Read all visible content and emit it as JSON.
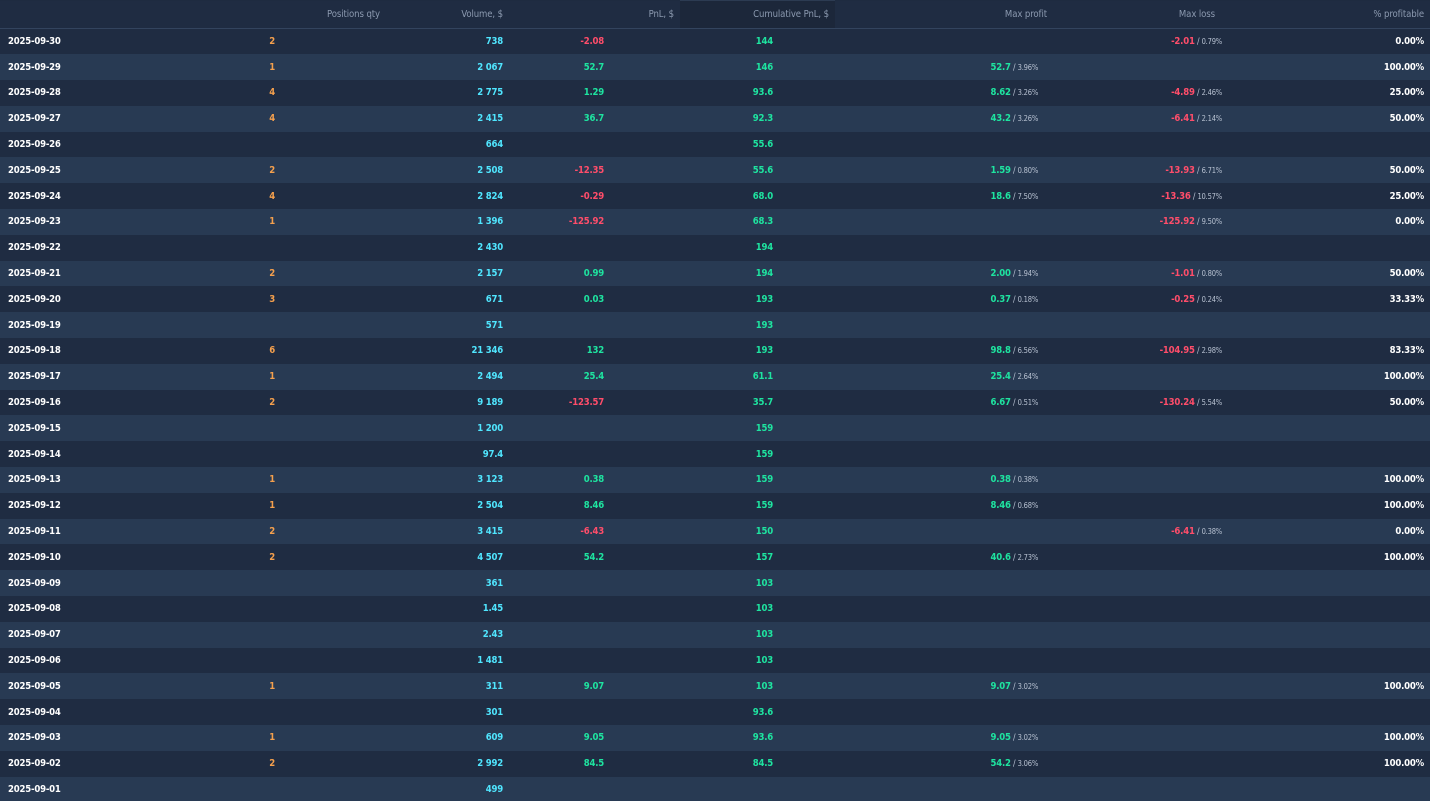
{
  "colors": {
    "background": "#1e2b40",
    "row_odd": "#1f2c42",
    "row_even": "#283a53",
    "header_text": "#8c9ab0",
    "positions_qty": "#f5a04d",
    "volume": "#50e6ff",
    "positive": "#1ee4a0",
    "negative": "#ff4d6a",
    "text": "#ffffff"
  },
  "table": {
    "headers": {
      "date": "",
      "positions_qty": "Positions qty",
      "volume": "Volume, $",
      "pnl": "PnL, $",
      "cumulative_pnl": "Cumulative PnL, $",
      "max_profit": "Max profit",
      "max_loss": "Max loss",
      "pct_profitable": "% profitable"
    },
    "rows": [
      {
        "date": "2025-09-30",
        "qty": "2",
        "volume": "738",
        "pnl": "-2.08",
        "cum": "144",
        "max_profit": "",
        "max_profit_pct": "",
        "max_loss": "-2.01",
        "max_loss_pct": "0.79%",
        "pct_profitable": "0.00%"
      },
      {
        "date": "2025-09-29",
        "qty": "1",
        "volume": "2 067",
        "pnl": "52.7",
        "cum": "146",
        "max_profit": "52.7",
        "max_profit_pct": "3.96%",
        "max_loss": "",
        "max_loss_pct": "",
        "pct_profitable": "100.00%"
      },
      {
        "date": "2025-09-28",
        "qty": "4",
        "volume": "2 775",
        "pnl": "1.29",
        "cum": "93.6",
        "max_profit": "8.62",
        "max_profit_pct": "3.26%",
        "max_loss": "-4.89",
        "max_loss_pct": "2.46%",
        "pct_profitable": "25.00%"
      },
      {
        "date": "2025-09-27",
        "qty": "4",
        "volume": "2 415",
        "pnl": "36.7",
        "cum": "92.3",
        "max_profit": "43.2",
        "max_profit_pct": "3.26%",
        "max_loss": "-6.41",
        "max_loss_pct": "2.14%",
        "pct_profitable": "50.00%"
      },
      {
        "date": "2025-09-26",
        "qty": "",
        "volume": "664",
        "pnl": "",
        "cum": "55.6",
        "max_profit": "",
        "max_profit_pct": "",
        "max_loss": "",
        "max_loss_pct": "",
        "pct_profitable": ""
      },
      {
        "date": "2025-09-25",
        "qty": "2",
        "volume": "2 508",
        "pnl": "-12.35",
        "cum": "55.6",
        "max_profit": "1.59",
        "max_profit_pct": "0.80%",
        "max_loss": "-13.93",
        "max_loss_pct": "6.71%",
        "pct_profitable": "50.00%"
      },
      {
        "date": "2025-09-24",
        "qty": "4",
        "volume": "2 824",
        "pnl": "-0.29",
        "cum": "68.0",
        "max_profit": "18.6",
        "max_profit_pct": "7.50%",
        "max_loss": "-13.36",
        "max_loss_pct": "10.57%",
        "pct_profitable": "25.00%"
      },
      {
        "date": "2025-09-23",
        "qty": "1",
        "volume": "1 396",
        "pnl": "-125.92",
        "cum": "68.3",
        "max_profit": "",
        "max_profit_pct": "",
        "max_loss": "-125.92",
        "max_loss_pct": "9.50%",
        "pct_profitable": "0.00%"
      },
      {
        "date": "2025-09-22",
        "qty": "",
        "volume": "2 430",
        "pnl": "",
        "cum": "194",
        "max_profit": "",
        "max_profit_pct": "",
        "max_loss": "",
        "max_loss_pct": "",
        "pct_profitable": ""
      },
      {
        "date": "2025-09-21",
        "qty": "2",
        "volume": "2 157",
        "pnl": "0.99",
        "cum": "194",
        "max_profit": "2.00",
        "max_profit_pct": "1.94%",
        "max_loss": "-1.01",
        "max_loss_pct": "0.80%",
        "pct_profitable": "50.00%"
      },
      {
        "date": "2025-09-20",
        "qty": "3",
        "volume": "671",
        "pnl": "0.03",
        "cum": "193",
        "max_profit": "0.37",
        "max_profit_pct": "0.18%",
        "max_loss": "-0.25",
        "max_loss_pct": "0.24%",
        "pct_profitable": "33.33%"
      },
      {
        "date": "2025-09-19",
        "qty": "",
        "volume": "571",
        "pnl": "",
        "cum": "193",
        "max_profit": "",
        "max_profit_pct": "",
        "max_loss": "",
        "max_loss_pct": "",
        "pct_profitable": ""
      },
      {
        "date": "2025-09-18",
        "qty": "6",
        "volume": "21 346",
        "pnl": "132",
        "cum": "193",
        "max_profit": "98.8",
        "max_profit_pct": "6.56%",
        "max_loss": "-104.95",
        "max_loss_pct": "2.98%",
        "pct_profitable": "83.33%"
      },
      {
        "date": "2025-09-17",
        "qty": "1",
        "volume": "2 494",
        "pnl": "25.4",
        "cum": "61.1",
        "max_profit": "25.4",
        "max_profit_pct": "2.64%",
        "max_loss": "",
        "max_loss_pct": "",
        "pct_profitable": "100.00%"
      },
      {
        "date": "2025-09-16",
        "qty": "2",
        "volume": "9 189",
        "pnl": "-123.57",
        "cum": "35.7",
        "max_profit": "6.67",
        "max_profit_pct": "0.51%",
        "max_loss": "-130.24",
        "max_loss_pct": "5.54%",
        "pct_profitable": "50.00%"
      },
      {
        "date": "2025-09-15",
        "qty": "",
        "volume": "1 200",
        "pnl": "",
        "cum": "159",
        "max_profit": "",
        "max_profit_pct": "",
        "max_loss": "",
        "max_loss_pct": "",
        "pct_profitable": ""
      },
      {
        "date": "2025-09-14",
        "qty": "",
        "volume": "97.4",
        "pnl": "",
        "cum": "159",
        "max_profit": "",
        "max_profit_pct": "",
        "max_loss": "",
        "max_loss_pct": "",
        "pct_profitable": ""
      },
      {
        "date": "2025-09-13",
        "qty": "1",
        "volume": "3 123",
        "pnl": "0.38",
        "cum": "159",
        "max_profit": "0.38",
        "max_profit_pct": "0.38%",
        "max_loss": "",
        "max_loss_pct": "",
        "pct_profitable": "100.00%"
      },
      {
        "date": "2025-09-12",
        "qty": "1",
        "volume": "2 504",
        "pnl": "8.46",
        "cum": "159",
        "max_profit": "8.46",
        "max_profit_pct": "0.68%",
        "max_loss": "",
        "max_loss_pct": "",
        "pct_profitable": "100.00%"
      },
      {
        "date": "2025-09-11",
        "qty": "2",
        "volume": "3 415",
        "pnl": "-6.43",
        "cum": "150",
        "max_profit": "",
        "max_profit_pct": "",
        "max_loss": "-6.41",
        "max_loss_pct": "0.38%",
        "pct_profitable": "0.00%"
      },
      {
        "date": "2025-09-10",
        "qty": "2",
        "volume": "4 507",
        "pnl": "54.2",
        "cum": "157",
        "max_profit": "40.6",
        "max_profit_pct": "2.73%",
        "max_loss": "",
        "max_loss_pct": "",
        "pct_profitable": "100.00%"
      },
      {
        "date": "2025-09-09",
        "qty": "",
        "volume": "361",
        "pnl": "",
        "cum": "103",
        "max_profit": "",
        "max_profit_pct": "",
        "max_loss": "",
        "max_loss_pct": "",
        "pct_profitable": ""
      },
      {
        "date": "2025-09-08",
        "qty": "",
        "volume": "1.45",
        "pnl": "",
        "cum": "103",
        "max_profit": "",
        "max_profit_pct": "",
        "max_loss": "",
        "max_loss_pct": "",
        "pct_profitable": ""
      },
      {
        "date": "2025-09-07",
        "qty": "",
        "volume": "2.43",
        "pnl": "",
        "cum": "103",
        "max_profit": "",
        "max_profit_pct": "",
        "max_loss": "",
        "max_loss_pct": "",
        "pct_profitable": ""
      },
      {
        "date": "2025-09-06",
        "qty": "",
        "volume": "1 481",
        "pnl": "",
        "cum": "103",
        "max_profit": "",
        "max_profit_pct": "",
        "max_loss": "",
        "max_loss_pct": "",
        "pct_profitable": ""
      },
      {
        "date": "2025-09-05",
        "qty": "1",
        "volume": "311",
        "pnl": "9.07",
        "cum": "103",
        "max_profit": "9.07",
        "max_profit_pct": "3.02%",
        "max_loss": "",
        "max_loss_pct": "",
        "pct_profitable": "100.00%"
      },
      {
        "date": "2025-09-04",
        "qty": "",
        "volume": "301",
        "pnl": "",
        "cum": "93.6",
        "max_profit": "",
        "max_profit_pct": "",
        "max_loss": "",
        "max_loss_pct": "",
        "pct_profitable": ""
      },
      {
        "date": "2025-09-03",
        "qty": "1",
        "volume": "609",
        "pnl": "9.05",
        "cum": "93.6",
        "max_profit": "9.05",
        "max_profit_pct": "3.02%",
        "max_loss": "",
        "max_loss_pct": "",
        "pct_profitable": "100.00%"
      },
      {
        "date": "2025-09-02",
        "qty": "2",
        "volume": "2 992",
        "pnl": "84.5",
        "cum": "84.5",
        "max_profit": "54.2",
        "max_profit_pct": "3.06%",
        "max_loss": "",
        "max_loss_pct": "",
        "pct_profitable": "100.00%"
      },
      {
        "date": "2025-09-01",
        "qty": "",
        "volume": "499",
        "pnl": "",
        "cum": "",
        "max_profit": "",
        "max_profit_pct": "",
        "max_loss": "",
        "max_loss_pct": "",
        "pct_profitable": ""
      }
    ]
  }
}
